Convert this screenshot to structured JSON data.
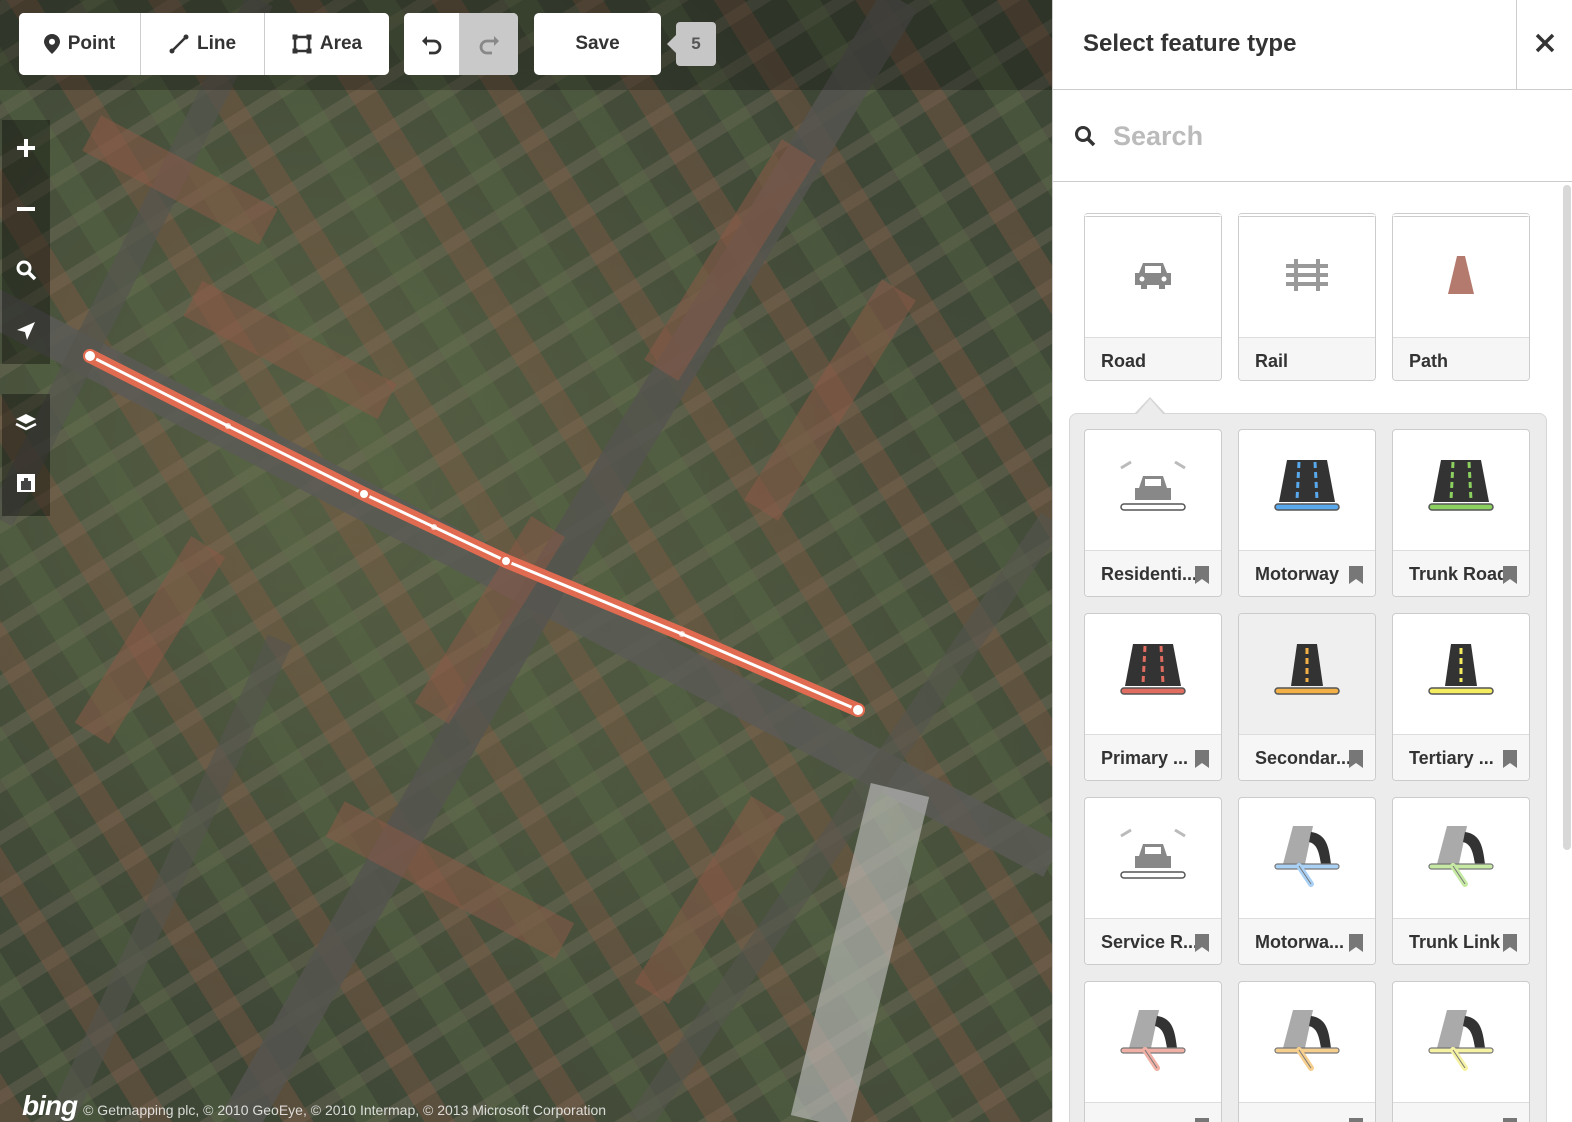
{
  "toolbar": {
    "point_label": "Point",
    "line_label": "Line",
    "area_label": "Area",
    "save_label": "Save",
    "save_count": "5"
  },
  "map": {
    "attribution": "© Getmapping plc, © 2010 GeoEye, © 2010 Intermap, © 2013 Microsoft Corporation",
    "imagery_logo": "bing",
    "drawn_line_color": "#e06b50",
    "controls": [
      "zoom-in-icon",
      "zoom-out-icon",
      "search-icon",
      "locate-icon",
      "layers-icon",
      "map-data-icon"
    ]
  },
  "sidebar": {
    "title": "Select feature type",
    "search_placeholder": "Search",
    "categories": [
      {
        "label": "Road",
        "icon": "car-icon"
      },
      {
        "label": "Rail",
        "icon": "rail-icon"
      },
      {
        "label": "Path",
        "icon": "path-icon"
      }
    ],
    "presets": [
      {
        "label": "Residenti...",
        "icon": "residential-road-icon",
        "color": "#ffffff"
      },
      {
        "label": "Motorway",
        "icon": "motorway-icon",
        "color": "#58a9ed"
      },
      {
        "label": "Trunk Road",
        "icon": "trunk-road-icon",
        "color": "#8cd05f"
      },
      {
        "label": "Primary ...",
        "icon": "primary-road-icon",
        "color": "#e06d5f"
      },
      {
        "label": "Secondar...",
        "icon": "secondary-road-icon",
        "color": "#f3b046"
      },
      {
        "label": "Tertiary ...",
        "icon": "tertiary-road-icon",
        "color": "#f4ed5f"
      },
      {
        "label": "Service R...",
        "icon": "service-road-icon",
        "color": "#ffffff"
      },
      {
        "label": "Motorwa...",
        "icon": "motorway-link-icon",
        "color": "#a9d0f5"
      },
      {
        "label": "Trunk Link",
        "icon": "trunk-link-icon",
        "color": "#c6e9a4"
      },
      {
        "label": "",
        "icon": "primary-link-icon",
        "color": "#f0b0a5"
      },
      {
        "label": "",
        "icon": "secondary-link-icon",
        "color": "#f6cf8e"
      },
      {
        "label": "",
        "icon": "tertiary-link-icon",
        "color": "#f6f2a4"
      }
    ]
  }
}
